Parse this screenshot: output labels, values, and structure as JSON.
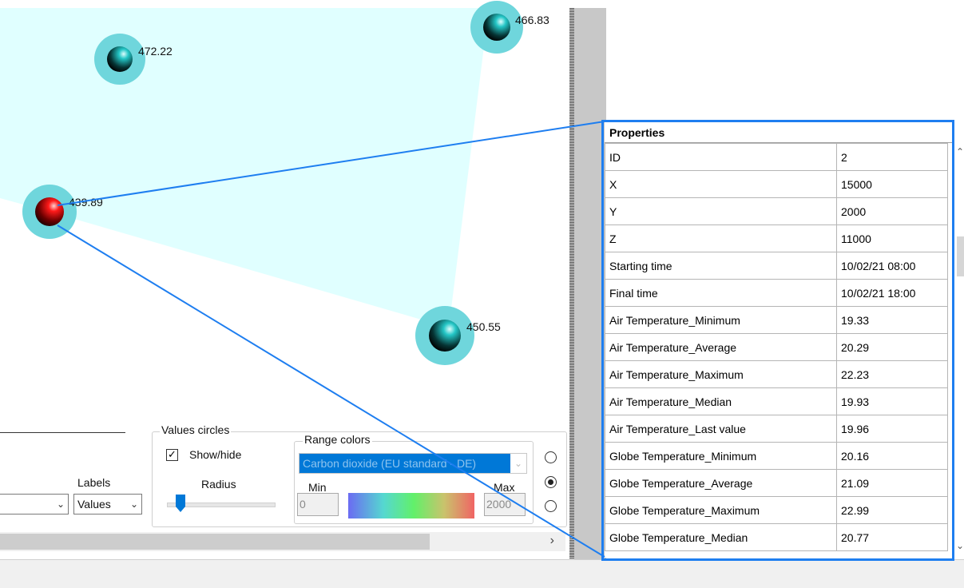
{
  "canvas": {
    "nodes": [
      {
        "label": "472.22",
        "state": "normal"
      },
      {
        "label": "466.83",
        "state": "normal"
      },
      {
        "label": "439.89",
        "state": "selected"
      },
      {
        "label": "450.55",
        "state": "normal"
      }
    ]
  },
  "controls": {
    "labels_title": "Labels",
    "labels_value": "Values",
    "values_circles_title": "Values circles",
    "show_hide_label": "Show/hide",
    "show_hide_checked": true,
    "radius_label": "Radius",
    "range_colors_title": "Range colors",
    "range_colors_value": "Carbon dioxide (EU standard - DE)",
    "min_label": "Min",
    "min_value": "0",
    "max_label": "Max",
    "max_value": "2000"
  },
  "properties": {
    "header": "Properties",
    "rows": [
      {
        "key": "ID",
        "value": "2"
      },
      {
        "key": "X",
        "value": "15000"
      },
      {
        "key": "Y",
        "value": "2000"
      },
      {
        "key": "Z",
        "value": "11000"
      },
      {
        "key": "Starting time",
        "value": "10/02/21 08:00"
      },
      {
        "key": "Final time",
        "value": "10/02/21 18:00"
      },
      {
        "key": "Air Temperature_Minimum",
        "value": "19.33"
      },
      {
        "key": "Air Temperature_Average",
        "value": "20.29"
      },
      {
        "key": "Air Temperature_Maximum",
        "value": "22.23"
      },
      {
        "key": "Air Temperature_Median",
        "value": "19.93"
      },
      {
        "key": "Air Temperature_Last value",
        "value": "19.96"
      },
      {
        "key": "Globe Temperature_Minimum",
        "value": "20.16"
      },
      {
        "key": "Globe Temperature_Average",
        "value": "21.09"
      },
      {
        "key": "Globe Temperature_Maximum",
        "value": "22.99"
      },
      {
        "key": "Globe Temperature_Median",
        "value": "20.77"
      }
    ]
  },
  "colors": {
    "highlight": "#1e7ef0",
    "area_fill": "#e0ffff",
    "node_halo": "#6fd6dc",
    "selected_node": "#e00000",
    "selection_blue": "#0078d7"
  }
}
